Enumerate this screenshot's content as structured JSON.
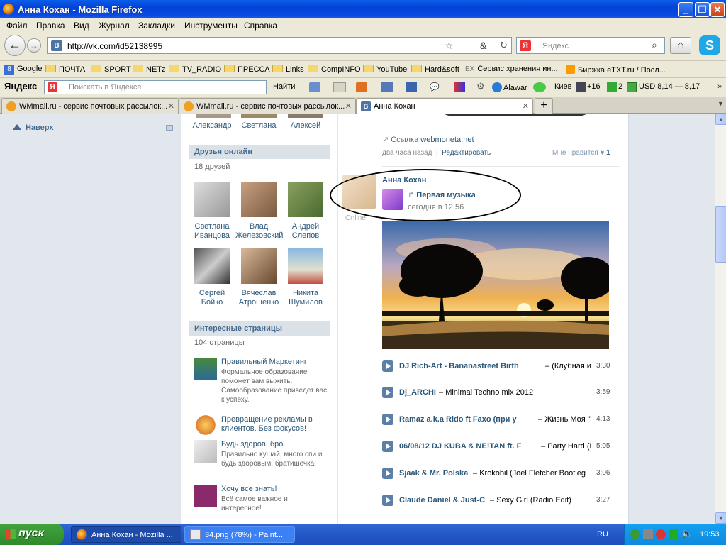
{
  "window": {
    "title": "Анна Кохан - Mozilla Firefox"
  },
  "menu": [
    "Файл",
    "Правка",
    "Вид",
    "Журнал",
    "Закладки",
    "Инструменты",
    "Справка"
  ],
  "nav": {
    "url": "http://vk.com/id52138995",
    "search_placeholder": "Яндекс"
  },
  "bookmarks": [
    "Google",
    "ПОЧТА",
    "SPORT",
    "NETz",
    "TV_RADIO",
    "ПРЕССА",
    "Links",
    "CompINFO",
    "YouTube",
    "Hard&soft",
    "Сервис хранения ин...",
    "Биржка eTXT.ru / Посл..."
  ],
  "yabar": {
    "logo": "Яндекс",
    "search_placeholder": "Поискать в Яндексе",
    "find": "Найти",
    "alawar": "Alawar",
    "city": "Киев",
    "temp": "+16",
    "mail_count": "2",
    "usd": "USD 8,14 — 8,17"
  },
  "tabs": [
    {
      "label": "WMmail.ru - сервис почтовых рассылок..."
    },
    {
      "label": "WMmail.ru - сервис почтовых рассылок..."
    },
    {
      "label": "Анна Кохан"
    }
  ],
  "left": {
    "up_label": "Наверх"
  },
  "friends_top": [
    "Александр",
    "Светлана",
    "Алексей"
  ],
  "online": {
    "header": "Друзья онлайн",
    "count": "18 друзей",
    "people": [
      {
        "first": "Светлана",
        "last": "Иванцова"
      },
      {
        "first": "Влад",
        "last": "Железовский"
      },
      {
        "first": "Андрей",
        "last": "Слепов"
      },
      {
        "first": "Сергей",
        "last": "Бойко"
      },
      {
        "first": "Вячеслав",
        "last": "Атрощенко"
      },
      {
        "first": "Никита",
        "last": "Шумилов"
      }
    ]
  },
  "pages": {
    "header": "Интересные страницы",
    "count": "104 страницы",
    "items": [
      {
        "title": "Правильный Маркетинг",
        "desc": "Формальное образование поможет вам выжить. Самообразование приведет вас к успеху."
      },
      {
        "title": "Превращение рекламы в клиентов. Без фокусов!",
        "desc": ""
      },
      {
        "title": "Будь здоров, бро.",
        "desc": "Правильно кушай, много спи и будь здоровым, братишечка!"
      },
      {
        "title": "Хочу все знать!",
        "desc": "Всё самое важное и интересное!"
      }
    ]
  },
  "post1": {
    "link_prefix": "Ссылка",
    "link": "webmoneta.net",
    "time": "два часа назад",
    "edit": "Редактировать",
    "like": "Мне нравится",
    "like_count": "1"
  },
  "post2": {
    "author": "Анна Кохан",
    "online": "Online",
    "shared_title": "Первая музыка",
    "date": "сегодня в 12:56"
  },
  "tracks": [
    {
      "artist": "DJ Rich-Art - Bananastreet Birth",
      "title": "(Клубная и Эл",
      "duration": "3:30"
    },
    {
      "artist": "Dj_ARCHI",
      "title": "Minimal Techno mix 2012",
      "duration": "3:59"
    },
    {
      "artist": "Ramaz a.k.a Rido ft Faxo (при у",
      "title": "Жизнь Моя \")",
      "duration": "4:13"
    },
    {
      "artist": "06/08/12 DJ KUBA & NE!TAN ft. F",
      "title": "Party Hard (Ec",
      "duration": "5:05"
    },
    {
      "artist": "Sjaak & Mr. Polska",
      "title": "Krokobil (Joel Fletcher Bootleg",
      "duration": "3:06"
    },
    {
      "artist": "Claude Daniel & Just-C",
      "title": "Sexy Girl (Radio Edit)",
      "duration": "3:27"
    }
  ],
  "taskbar": {
    "start": "пуск",
    "items": [
      "Анна Кохан - Mozilla ...",
      "34.png (78%) - Paint..."
    ],
    "lang": "RU",
    "clock": "19:53"
  }
}
